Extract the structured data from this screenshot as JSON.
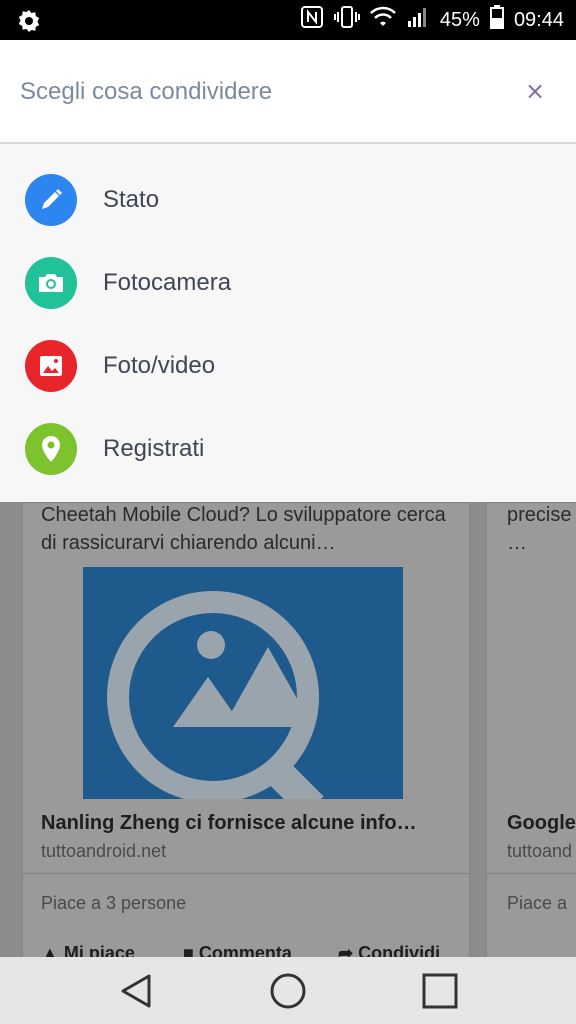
{
  "status_bar": {
    "battery": "45%",
    "time": "09:44",
    "icons": [
      "settings-cog-icon",
      "nfc-icon",
      "vibrate-icon",
      "wifi-icon",
      "signal-icon",
      "battery-icon"
    ]
  },
  "sheet": {
    "title": "Scegli cosa condividere",
    "close": "×",
    "items": [
      {
        "label": "Stato",
        "icon": "pencil-icon",
        "color": "#2d86f0"
      },
      {
        "label": "Fotocamera",
        "icon": "camera-icon",
        "color": "#21c19a"
      },
      {
        "label": "Foto/video",
        "icon": "photo-icon",
        "color": "#e8252b"
      },
      {
        "label": "Registrati",
        "icon": "location-pin-icon",
        "color": "#7dc32e"
      }
    ]
  },
  "background": {
    "card1": {
      "text": "Cheetah Mobile Cloud? Lo sviluppatore cerca di rassicurarvi chiarendo alcuni…",
      "headline": "Nanling Zheng ci fornisce alcune info…",
      "source": "tuttoandroid.net",
      "likes": "Piace a 3 persone",
      "actions": [
        "Mi piace",
        "Commenta",
        "Condividi"
      ]
    },
    "card2": {
      "text": "precise …",
      "headline": "Google",
      "source": "tuttoand",
      "likes": "Piace a"
    }
  },
  "nav": {
    "icons": [
      "back-icon",
      "home-icon",
      "recents-icon"
    ]
  }
}
